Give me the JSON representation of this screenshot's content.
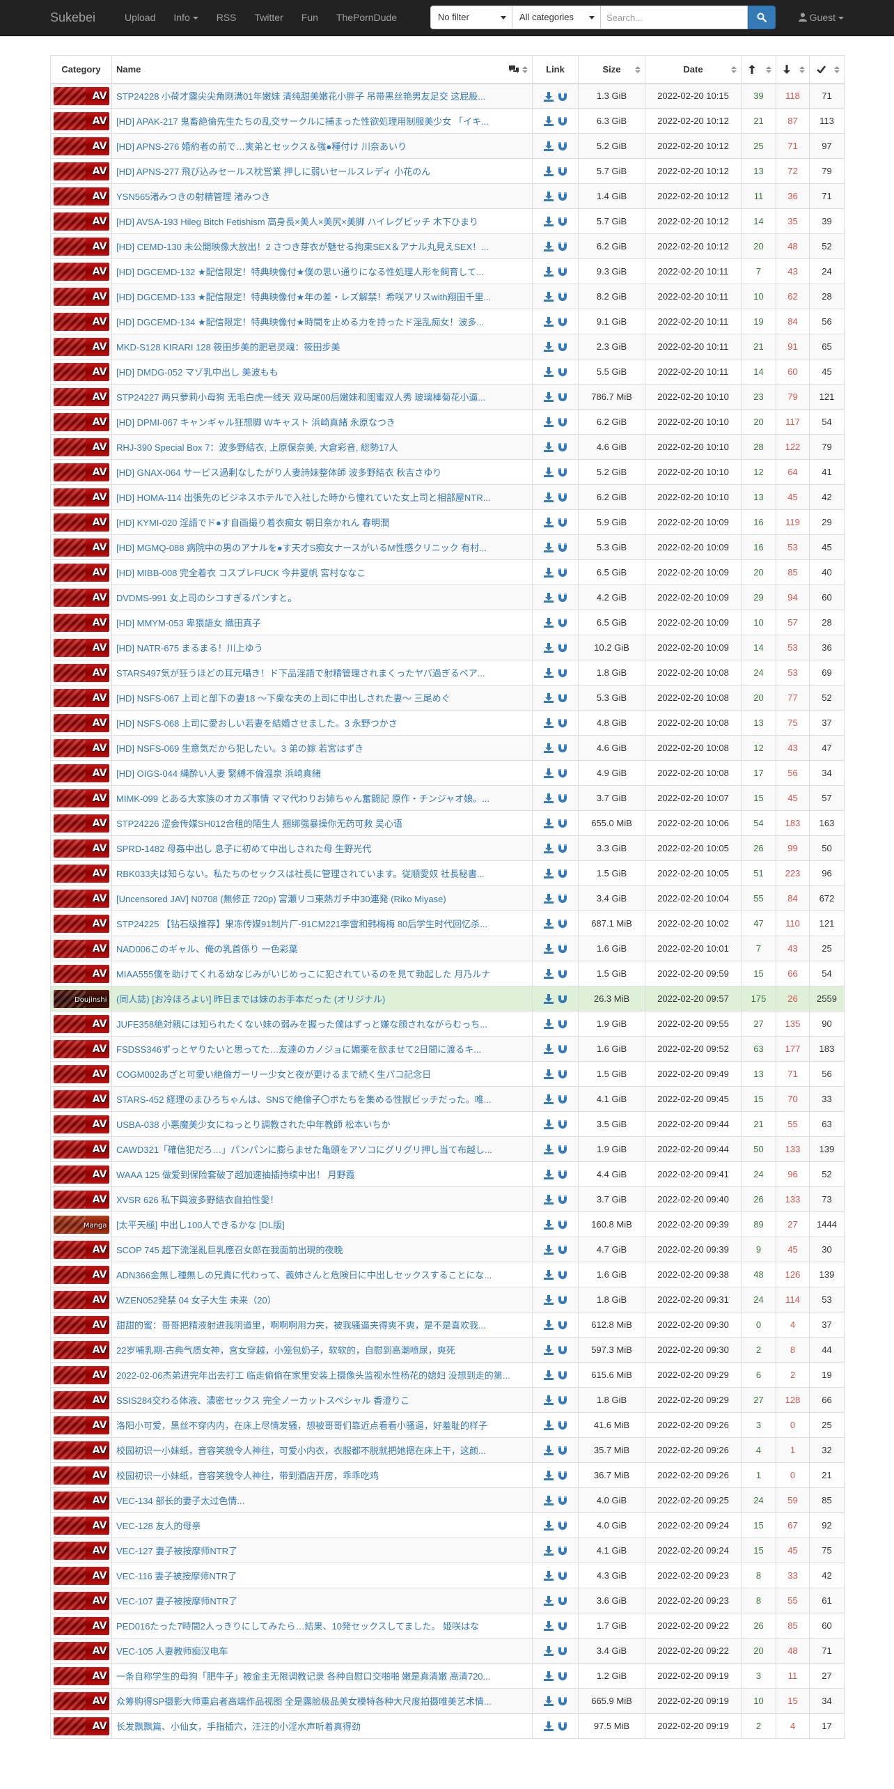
{
  "navbar": {
    "brand": "Sukebei",
    "links": [
      "Upload",
      "Info",
      "RSS",
      "Twitter",
      "Fun",
      "ThePornDude"
    ],
    "filter_selected": "No filter",
    "category_selected": "All categories",
    "search_placeholder": "Search...",
    "guest_label": "Guest"
  },
  "columns": [
    "Category",
    "Name",
    "Link",
    "Size",
    "Date"
  ],
  "category_labels": {
    "av": "AV",
    "doujinshi": "Doujinshi",
    "manga": "Manga"
  },
  "rows": [
    {
      "cat": "av",
      "name": "STP24228 小荷才露尖尖角刚满01年嫩妹 清纯甜美嫩花小胖子 吊带黑丝艳男友足交 这屁股...",
      "size": "1.3 GiB",
      "date": "2022-02-20 10:15",
      "seeders": "39",
      "leechers": "118",
      "completed": "71"
    },
    {
      "cat": "av",
      "name": "[HD] APAK-217 鬼畜絶倫先生たちの乱交サークルに捕まった性欲処理用制服美少女 「イキ...",
      "size": "6.3 GiB",
      "date": "2022-02-20 10:12",
      "seeders": "21",
      "leechers": "87",
      "completed": "113"
    },
    {
      "cat": "av",
      "name": "[HD] APNS-276 婚約者の前で…実弟とセックス＆強●種付け 川奈あいり",
      "size": "5.2 GiB",
      "date": "2022-02-20 10:12",
      "seeders": "25",
      "leechers": "71",
      "completed": "97"
    },
    {
      "cat": "av",
      "name": "[HD] APNS-277 飛び込みセールス枕営業 押しに弱いセールスレディ 小花のん",
      "size": "5.7 GiB",
      "date": "2022-02-20 10:12",
      "seeders": "13",
      "leechers": "72",
      "completed": "79"
    },
    {
      "cat": "av",
      "name": "YSN565渚みつきの射精管理 渚みつき",
      "size": "1.4 GiB",
      "date": "2022-02-20 10:12",
      "seeders": "11",
      "leechers": "36",
      "completed": "71"
    },
    {
      "cat": "av",
      "name": "[HD] AVSA-193 Hileg Bitch Fetishism 高身長×美人×美尻×美脚 ハイレグビッチ 木下ひまり",
      "size": "5.7 GiB",
      "date": "2022-02-20 10:12",
      "seeders": "14",
      "leechers": "35",
      "completed": "39"
    },
    {
      "cat": "av",
      "name": "[HD] CEMD-130 未公開映像大放出！2 さつき芽衣が魅せる拘束SEX＆アナル丸見えSEX！...",
      "size": "6.2 GiB",
      "date": "2022-02-20 10:12",
      "seeders": "20",
      "leechers": "48",
      "completed": "52"
    },
    {
      "cat": "av",
      "name": "[HD] DGCEMD-132 ★配信限定！特典映像付★僕の思い通りになる性処理人形を飼育して...",
      "size": "9.3 GiB",
      "date": "2022-02-20 10:11",
      "seeders": "7",
      "leechers": "43",
      "completed": "24"
    },
    {
      "cat": "av",
      "name": "[HD] DGCEMD-133 ★配信限定！特典映像付★年の差・レズ解禁！希咲アリスwith翔田千里...",
      "size": "8.2 GiB",
      "date": "2022-02-20 10:11",
      "seeders": "10",
      "leechers": "62",
      "completed": "28"
    },
    {
      "cat": "av",
      "name": "[HD] DGCEMD-134 ★配信限定！特典映像付★時間を止める力を持ったド淫乱痴女！波多...",
      "size": "9.1 GiB",
      "date": "2022-02-20 10:11",
      "seeders": "19",
      "leechers": "84",
      "completed": "56"
    },
    {
      "cat": "av",
      "name": "MKD-S128 KIRARI 128 筱田步美的肥皂灵魂：筱田步美",
      "size": "2.3 GiB",
      "date": "2022-02-20 10:11",
      "seeders": "21",
      "leechers": "91",
      "completed": "65"
    },
    {
      "cat": "av",
      "name": "[HD] DMDG-052 マゾ乳中出し 美波もも",
      "size": "5.5 GiB",
      "date": "2022-02-20 10:11",
      "seeders": "14",
      "leechers": "60",
      "completed": "45"
    },
    {
      "cat": "av",
      "name": "STP24227 两只萝莉小母狗 无毛白虎一线天 双马尾00后嫩妹和闺蜜双人秀 玻璃棒菊花小逼...",
      "size": "786.7 MiB",
      "date": "2022-02-20 10:10",
      "seeders": "23",
      "leechers": "79",
      "completed": "121"
    },
    {
      "cat": "av",
      "name": "[HD] DPMI-067 キャンギャル狂想脚 Wキャスト 浜崎真緒 永原なつき",
      "size": "6.2 GiB",
      "date": "2022-02-20 10:10",
      "seeders": "20",
      "leechers": "117",
      "completed": "54"
    },
    {
      "cat": "av",
      "name": "RHJ-390 Special Box 7：波多野結衣, 上原保奈美, 大倉彩音, 総勢17人",
      "size": "4.6 GiB",
      "date": "2022-02-20 10:10",
      "seeders": "28",
      "leechers": "122",
      "completed": "79"
    },
    {
      "cat": "av",
      "name": "[HD] GNAX-064 サービス過剰なしたがり人妻詩妹整体師 波多野結衣 秋吉さゆり",
      "size": "5.2 GiB",
      "date": "2022-02-20 10:10",
      "seeders": "12",
      "leechers": "64",
      "completed": "41"
    },
    {
      "cat": "av",
      "name": "[HD] HOMA-114 出張先のビジネスホテルで入社した時から憧れていた女上司と相部屋NTR...",
      "size": "6.2 GiB",
      "date": "2022-02-20 10:10",
      "seeders": "13",
      "leechers": "45",
      "completed": "42"
    },
    {
      "cat": "av",
      "name": "[HD] KYMI-020 淫語でド●す自画撮り着衣痴女 朝日奈かれん 春明潤",
      "size": "5.9 GiB",
      "date": "2022-02-20 10:09",
      "seeders": "16",
      "leechers": "119",
      "completed": "29"
    },
    {
      "cat": "av",
      "name": "[HD] MGMQ-088 病院中の男のアナルを●す天才S痴女ナースがいるM性感クリニック 有村...",
      "size": "5.3 GiB",
      "date": "2022-02-20 10:09",
      "seeders": "16",
      "leechers": "53",
      "completed": "45"
    },
    {
      "cat": "av",
      "name": "[HD] MIBB-008 完全着衣 コスプレFUCK 今井夏帆 宮村ななこ",
      "size": "6.5 GiB",
      "date": "2022-02-20 10:09",
      "seeders": "20",
      "leechers": "85",
      "completed": "40"
    },
    {
      "cat": "av",
      "name": "DVDMS-991 女上司のシコすぎるパンすと。",
      "size": "4.2 GiB",
      "date": "2022-02-20 10:09",
      "seeders": "29",
      "leechers": "94",
      "completed": "60"
    },
    {
      "cat": "av",
      "name": "[HD] MMYM-053 卑猥語女 織田真子",
      "size": "6.5 GiB",
      "date": "2022-02-20 10:09",
      "seeders": "10",
      "leechers": "57",
      "completed": "28"
    },
    {
      "cat": "av",
      "name": "[HD] NATR-675 まるまる！川上ゆう",
      "size": "10.2 GiB",
      "date": "2022-02-20 10:09",
      "seeders": "14",
      "leechers": "53",
      "completed": "36"
    },
    {
      "cat": "av",
      "name": "STARS497気が狂うほどの耳元囁き！ド下品淫語で射精管理されまくったヤバ過ぎるベア...",
      "size": "1.8 GiB",
      "date": "2022-02-20 10:08",
      "seeders": "24",
      "leechers": "53",
      "completed": "69"
    },
    {
      "cat": "av",
      "name": "[HD] NSFS-067 上司と部下の妻18 ～下衆な夫の上司に中出しされた妻～ 三尾めぐ",
      "size": "5.3 GiB",
      "date": "2022-02-20 10:08",
      "seeders": "20",
      "leechers": "77",
      "completed": "52"
    },
    {
      "cat": "av",
      "name": "[HD] NSFS-068 上司に愛おしい若妻を結婚させました。3 永野つかさ",
      "size": "4.8 GiB",
      "date": "2022-02-20 10:08",
      "seeders": "13",
      "leechers": "75",
      "completed": "37"
    },
    {
      "cat": "av",
      "name": "[HD] NSFS-069 生意気だから犯したい。3 弟の嫁 若宮はずき",
      "size": "4.6 GiB",
      "date": "2022-02-20 10:08",
      "seeders": "12",
      "leechers": "43",
      "completed": "47"
    },
    {
      "cat": "av",
      "name": "[HD] OIGS-044 縄酔い人妻 緊縛不倫温泉 浜崎真緒",
      "size": "4.9 GiB",
      "date": "2022-02-20 10:08",
      "seeders": "17",
      "leechers": "56",
      "completed": "34"
    },
    {
      "cat": "av",
      "name": "MIMK-099 とある大家族のオカズ事情 ママ代わりお姉ちゃん奮闘記 原作・チンジャオ娘。...",
      "size": "3.7 GiB",
      "date": "2022-02-20 10:07",
      "seeders": "15",
      "leechers": "45",
      "completed": "57"
    },
    {
      "cat": "av",
      "name": "STP24226 涩会传媒SH012合租的陌生人 捆绑强暴操你无药可救 吴心语",
      "size": "655.0 MiB",
      "date": "2022-02-20 10:06",
      "seeders": "54",
      "leechers": "183",
      "completed": "163"
    },
    {
      "cat": "av",
      "name": "SPRD-1482 母姦中出し 息子に初めて中出しされた母 生野光代",
      "size": "3.3 GiB",
      "date": "2022-02-20 10:05",
      "seeders": "26",
      "leechers": "99",
      "completed": "50"
    },
    {
      "cat": "av",
      "name": "RBK033夫は知らない。私たちのセックスは社長に管理されています。従順愛奴 社長秘書...",
      "size": "1.5 GiB",
      "date": "2022-02-20 10:05",
      "seeders": "51",
      "leechers": "223",
      "completed": "96"
    },
    {
      "cat": "av",
      "name": "[Uncensored JAV] N0708 (無修正 720p) 宮瀬リコ東熱ガチ中30連発 (Riko Miyase)",
      "size": "3.4 GiB",
      "date": "2022-02-20 10:04",
      "seeders": "55",
      "leechers": "84",
      "completed": "672"
    },
    {
      "cat": "av",
      "name": "STP24225 【钻石级推荐】果冻传媒91制片厂-91CM221李雷和韩梅梅 80后学生时代回忆杀...",
      "size": "687.1 MiB",
      "date": "2022-02-20 10:02",
      "seeders": "47",
      "leechers": "110",
      "completed": "121"
    },
    {
      "cat": "av",
      "name": "NAD006このギャル、俺の乳首係り 一色彩葉",
      "size": "1.6 GiB",
      "date": "2022-02-20 10:01",
      "seeders": "7",
      "leechers": "43",
      "completed": "25"
    },
    {
      "cat": "av",
      "name": "MIAA555僕を助けてくれる幼なじみがいじめっこに犯されているのを見て勃起した 月乃ルナ",
      "size": "1.5 GiB",
      "date": "2022-02-20 09:59",
      "seeders": "15",
      "leechers": "66",
      "completed": "54"
    },
    {
      "cat": "doujinshi",
      "name": "(同人誌) [お冷ほろよい] 昨日までは妹のお手本だった (オリジナル)",
      "size": "26.3 MiB",
      "date": "2022-02-20 09:57",
      "seeders": "175",
      "leechers": "26",
      "completed": "2559",
      "success": true
    },
    {
      "cat": "av",
      "name": "JUFE358絶対親には知られたくない妹の弱みを握った僕はずっと嫌な顔されながらむっち...",
      "size": "1.9 GiB",
      "date": "2022-02-20 09:55",
      "seeders": "27",
      "leechers": "135",
      "completed": "90"
    },
    {
      "cat": "av",
      "name": "FSDSS346ずっとヤりたいと思ってた…友達のカノジョに媚薬を飲ませて2日間に渡るキ...",
      "size": "1.6 GiB",
      "date": "2022-02-20 09:52",
      "seeders": "63",
      "leechers": "177",
      "completed": "183"
    },
    {
      "cat": "av",
      "name": "COGM002あざと可愛い絶倫ガーリー少女と夜が更けるまで続く生パコ記念日",
      "size": "1.5 GiB",
      "date": "2022-02-20 09:49",
      "seeders": "13",
      "leechers": "71",
      "completed": "56"
    },
    {
      "cat": "av",
      "name": "STARS-452 経理のまひろちゃんは、SNSで絶倫子〇ボたちを集める性獣ビッチだった。唯...",
      "size": "4.1 GiB",
      "date": "2022-02-20 09:45",
      "seeders": "15",
      "leechers": "70",
      "completed": "33"
    },
    {
      "cat": "av",
      "name": "USBA-038 小悪魔美少女にねっとり調教された中年教師 松本いちか",
      "size": "3.5 GiB",
      "date": "2022-02-20 09:44",
      "seeders": "21",
      "leechers": "55",
      "completed": "63"
    },
    {
      "cat": "av",
      "name": "CAWD321「確信犯だろ…」パンパンに膨らませた亀頭をアソコにグリグリ押し当て布越し...",
      "size": "1.9 GiB",
      "date": "2022-02-20 09:44",
      "seeders": "50",
      "leechers": "133",
      "completed": "139"
    },
    {
      "cat": "av",
      "name": "WAAA 125 做爱到保险套破了超加速抽插持续中出！ 月野霞",
      "size": "4.4 GiB",
      "date": "2022-02-20 09:41",
      "seeders": "24",
      "leechers": "96",
      "completed": "52"
    },
    {
      "cat": "av",
      "name": "XVSR 626 私下與波多野結衣自拍性愛！",
      "size": "3.7 GiB",
      "date": "2022-02-20 09:40",
      "seeders": "26",
      "leechers": "133",
      "completed": "73"
    },
    {
      "cat": "manga",
      "name": "[太平天極] 中出し100人できるかな [DL版]",
      "size": "160.8 MiB",
      "date": "2022-02-20 09:39",
      "seeders": "89",
      "leechers": "27",
      "completed": "1444"
    },
    {
      "cat": "av",
      "name": "SCOP 745 超下流淫亂巨乳應召女郎在我面前出現的夜晚",
      "size": "4.7 GiB",
      "date": "2022-02-20 09:39",
      "seeders": "9",
      "leechers": "45",
      "completed": "30"
    },
    {
      "cat": "av",
      "name": "ADN366金無し種無しの兄貴に代わって、義姉さんと危険日に中出しセックスすることにな...",
      "size": "1.6 GiB",
      "date": "2022-02-20 09:38",
      "seeders": "48",
      "leechers": "126",
      "completed": "139"
    },
    {
      "cat": "av",
      "name": "WZEN052発禁 04 女子大生 未来（20）",
      "size": "1.8 GiB",
      "date": "2022-02-20 09:31",
      "seeders": "24",
      "leechers": "114",
      "completed": "53"
    },
    {
      "cat": "av",
      "name": "甜甜的蜜：哥哥把精液射进我阴道里，啊啊啊用力夹，被我骚逼夹得爽不爽，是不是喜欢我...",
      "size": "612.8 MiB",
      "date": "2022-02-20 09:30",
      "seeders": "0",
      "leechers": "4",
      "completed": "37"
    },
    {
      "cat": "av",
      "name": "22岁哺乳期-古典气质女神，宫女穿越，小笼包奶子，软软的，自慰到高潮喷尿，爽死",
      "size": "597.3 MiB",
      "date": "2022-02-20 09:30",
      "seeders": "2",
      "leechers": "8",
      "completed": "44"
    },
    {
      "cat": "av",
      "name": "2022-02-06杰弟进完年出去打工 临走偷偷在家里安装上摄像头监视水性杨花的媳妇 没想到走的第...",
      "size": "615.6 MiB",
      "date": "2022-02-20 09:29",
      "seeders": "6",
      "leechers": "2",
      "completed": "19"
    },
    {
      "cat": "av",
      "name": "SSIS284交わる体液、濃密セックス 完全ノーカットスペシャル 香澄りこ",
      "size": "1.8 GiB",
      "date": "2022-02-20 09:29",
      "seeders": "27",
      "leechers": "128",
      "completed": "66"
    },
    {
      "cat": "av",
      "name": "洛阳小可爱，黑丝不穿内内，在床上尽情发骚，想被哥哥们靠近点看看小骚逼，好羞耻的样子",
      "size": "41.6 MiB",
      "date": "2022-02-20 09:26",
      "seeders": "3",
      "leechers": "0",
      "completed": "25"
    },
    {
      "cat": "av",
      "name": "校园初识一小妹纸，音容笑貌令人神往，可爱小内衣，衣服都不脱就把她摁在床上干，这颜...",
      "size": "35.7 MiB",
      "date": "2022-02-20 09:26",
      "seeders": "4",
      "leechers": "1",
      "completed": "32"
    },
    {
      "cat": "av",
      "name": "校园初识一小妹纸，音容笑貌令人神往，带到酒店开房，乖乖吃鸡",
      "size": "36.7 MiB",
      "date": "2022-02-20 09:26",
      "seeders": "1",
      "leechers": "0",
      "completed": "21"
    },
    {
      "cat": "av",
      "name": "VEC-134 部长的妻子太过色情...",
      "size": "4.0 GiB",
      "date": "2022-02-20 09:25",
      "seeders": "24",
      "leechers": "59",
      "completed": "85"
    },
    {
      "cat": "av",
      "name": "VEC-128 友人的母亲",
      "size": "4.0 GiB",
      "date": "2022-02-20 09:24",
      "seeders": "15",
      "leechers": "67",
      "completed": "92"
    },
    {
      "cat": "av",
      "name": "VEC-127 妻子被按摩师NTR了",
      "size": "4.1 GiB",
      "date": "2022-02-20 09:24",
      "seeders": "15",
      "leechers": "45",
      "completed": "75"
    },
    {
      "cat": "av",
      "name": "VEC-116 妻子被按摩师NTR了",
      "size": "4.3 GiB",
      "date": "2022-02-20 09:23",
      "seeders": "8",
      "leechers": "33",
      "completed": "42"
    },
    {
      "cat": "av",
      "name": "VEC-107 妻子被按摩师NTR了",
      "size": "3.6 GiB",
      "date": "2022-02-20 09:23",
      "seeders": "8",
      "leechers": "55",
      "completed": "61"
    },
    {
      "cat": "av",
      "name": "PED016たった7時間2人っきりにしてみたら…結果、10発セックスしてました。 姫咲はな",
      "size": "1.7 GiB",
      "date": "2022-02-20 09:22",
      "seeders": "26",
      "leechers": "85",
      "completed": "60"
    },
    {
      "cat": "av",
      "name": "VEC-105 人妻教师痴汉电车",
      "size": "3.4 GiB",
      "date": "2022-02-20 09:22",
      "seeders": "20",
      "leechers": "48",
      "completed": "71"
    },
    {
      "cat": "av",
      "name": "一条自称学生的母狗「肥牛子」被金主无限调教记录 各种自慰口交啪啪 嫩是真清嫩 高清720...",
      "size": "1.2 GiB",
      "date": "2022-02-20 09:19",
      "seeders": "3",
      "leechers": "11",
      "completed": "27"
    },
    {
      "cat": "av",
      "name": "众筹购得SP摄影大师重启者高端作品视图 全是露脸极品美女模特各种大尺度拍摄唯美艺术情...",
      "size": "665.9 MiB",
      "date": "2022-02-20 09:19",
      "seeders": "10",
      "leechers": "15",
      "completed": "34"
    },
    {
      "cat": "av",
      "name": "长发飘飘篇、小仙女，手指插穴，汪汪的小淫水声听着真得劲",
      "size": "97.5 MiB",
      "date": "2022-02-20 09:19",
      "seeders": "2",
      "leechers": "4",
      "completed": "17"
    }
  ],
  "colors": {
    "accent": "#337ab7",
    "seeders": "#3c763d",
    "leechers": "#d9534f",
    "navbar": "#222222"
  },
  "icons": {
    "comments": "comments-icon",
    "seeders": "arrow-up-icon",
    "leechers": "arrow-down-icon",
    "completed": "check-icon",
    "download": "download-icon",
    "magnet": "magnet-icon",
    "search": "search-icon"
  }
}
